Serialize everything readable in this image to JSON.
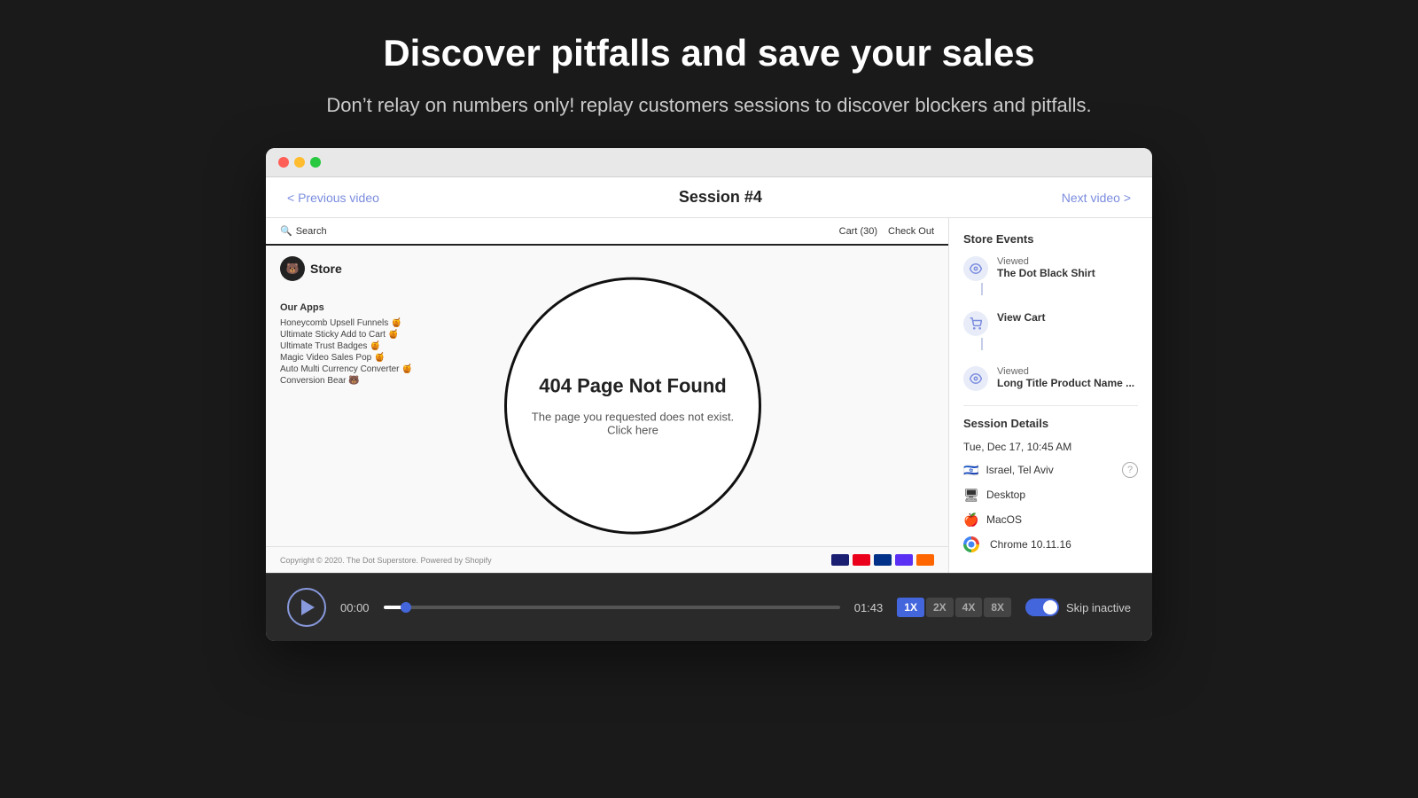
{
  "page": {
    "title": "Discover pitfalls and save your sales",
    "subtitle": "Don’t relay on numbers only! replay customers sessions to discover blockers and pitfalls."
  },
  "browser": {
    "dots": [
      "red",
      "yellow",
      "green"
    ]
  },
  "session": {
    "prev_link": "< Previous video",
    "title": "Session #4",
    "next_link": "Next video >"
  },
  "store": {
    "nav_search": "Search",
    "nav_cart": "Cart (30)",
    "nav_checkout": "Check Out",
    "logo_text": "Store",
    "error_title": "404 Page Not Found",
    "error_body": "The page you requested does not exist. Click here",
    "apps_heading": "Our Apps",
    "apps": [
      "Honeycomb Upsell Funnels 🍯",
      "Ultimate Sticky Add to Cart 🍯",
      "Ultimate Trust Badges 🍯",
      "Magic Video Sales Pop 🍯",
      "Auto Multi Currency Converter 🍯",
      "Conversion Bear 🐻"
    ],
    "footer_copyright": "Copyright © 2020. The Dot Superstore. Powered by Shopify"
  },
  "store_events": {
    "title": "Store Events",
    "events": [
      {
        "type": "viewed",
        "label": "Viewed",
        "value": "The Dot Black Shirt"
      },
      {
        "type": "cart",
        "label": "View Cart",
        "value": ""
      },
      {
        "type": "viewed",
        "label": "Viewed",
        "value": "Long Title Product Name ..."
      }
    ]
  },
  "session_details": {
    "title": "Session Details",
    "datetime": "Tue, Dec 17, 10:45 AM",
    "location": "Israel, Tel Aviv",
    "device": "Desktop",
    "os": "MacOS",
    "browser": "Chrome 10.11.16"
  },
  "playback": {
    "play_label": "Play",
    "time_current": "00:00",
    "time_total": "01:43",
    "speed_options": [
      "1X",
      "2X",
      "4X",
      "8X"
    ],
    "speed_active": "1X",
    "skip_label": "Skip inactive"
  }
}
